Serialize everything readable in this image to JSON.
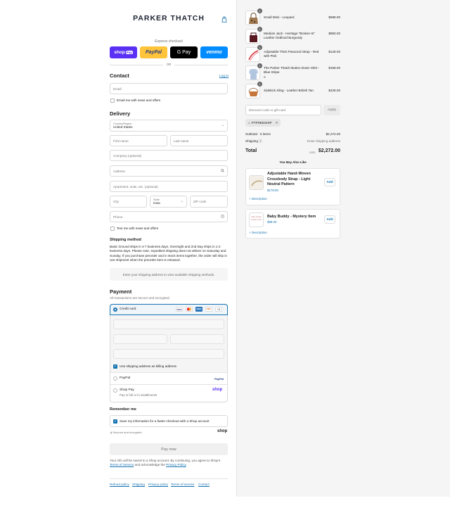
{
  "header": {
    "brand": "PARKER THATCH"
  },
  "express": {
    "label": "Express checkout",
    "shop_pay": "shop",
    "shop_pay_badge": "Pay",
    "paypal": "PayPal",
    "gpay": "G Pay",
    "venmo": "venmo",
    "or": "OR"
  },
  "contact": {
    "title": "Contact",
    "login": "Log in",
    "email_placeholder": "Email",
    "news_label": "Email me with news and offers"
  },
  "delivery": {
    "title": "Delivery",
    "country_label": "Country/Region",
    "country_value": "United States",
    "first_name": "First name",
    "last_name": "Last name",
    "company": "Company (optional)",
    "address": "Address",
    "apartment": "Apartment, suite, etc. (optional)",
    "city": "City",
    "state_label": "State",
    "state_value": "Iowa",
    "zip": "ZIP code",
    "phone": "Phone",
    "text_label": "Text me with news and offers"
  },
  "shipping": {
    "title": "Shipping method",
    "text": "Basic Ground ships in 4-7 business days. Overnight and 2nd Day ships in 1-2 business days. Please note, expedited shipping does not deliver on Saturday and Sunday. If you purchase preorder and in stock items together, the order will ship in one shipment when the preorder item is released.",
    "info": "Enter your shipping address to view available shipping methods."
  },
  "payment": {
    "title": "Payment",
    "subtitle": "All transactions are secure and encrypted.",
    "credit_card": "Credit card",
    "more_cards": "+5",
    "billing_label": "Use shipping address as billing address",
    "paypal": "PayPal",
    "shop_pay": "Shop Pay",
    "shop_pay_sub": "Pay in full or in installments",
    "card_icons": [
      "VISA",
      "MC",
      "AMEX",
      "DISC"
    ]
  },
  "remember": {
    "title": "Remember me",
    "save_label": "Save my information for a faster checkout with a Shop account",
    "secure": "Secured and encrypted",
    "shop_logo": "shop"
  },
  "pay_now": "Pay now",
  "legal": {
    "pre": "Your info will be saved to a Shop account. By continuing, you agree to Shop’s ",
    "terms": "Terms of Service",
    "mid": " and acknowledge the ",
    "privacy": "Privacy Policy",
    "post": "."
  },
  "footer_links": [
    "Refund policy",
    "Shipping",
    "Privacy policy",
    "Terms of service",
    "Contact"
  ],
  "cart": {
    "items": [
      {
        "name": "Small Mimi - Leopard",
        "price": "$698.00",
        "qty": "1",
        "variant": ""
      },
      {
        "name": "Medium Jack - Heritage \"Broken-In\" Leather Oxblood Burgundy",
        "price": "$850.00",
        "qty": "1",
        "variant": ""
      },
      {
        "name": "Adjustable Thick Paracord Strap - Red with Pink",
        "price": "$128.00",
        "qty": "1",
        "variant": ""
      },
      {
        "name": "The Parker Thatch Button Down Shirt - Blue Stripe",
        "price": "$168.00",
        "qty": "1",
        "variant": "S"
      },
      {
        "name": "Sidekick Sling - Leather British Tan",
        "price": "$428.00",
        "qty": "1",
        "variant": ""
      }
    ],
    "discount_placeholder": "Discount code or gift card",
    "apply": "Apply",
    "code": "PTFREESHIP",
    "subtotal_label": "Subtotal · 5 items",
    "subtotal": "$2,272.00",
    "shipping_label": "Shipping",
    "shipping_value": "Enter shipping address",
    "total_label": "Total",
    "currency": "USD",
    "total": "$2,272.00",
    "also_like": "You May Also Like",
    "recs": [
      {
        "name": "Adjustable Hand-Woven Crossbody Strap - Light Neutral Pattern",
        "price": "$178.00",
        "add": "Add",
        "desc": "Description"
      },
      {
        "name": "Baby Buddy - Mystery Item",
        "price": "$98.00",
        "add": "Add",
        "desc": "Description",
        "thumb_text": "baby buddy mystery item"
      }
    ]
  },
  "colors": {
    "accent": "#1773b0",
    "shop": "#5a31f4",
    "paypal": "#ffc439",
    "venmo": "#008cff"
  }
}
